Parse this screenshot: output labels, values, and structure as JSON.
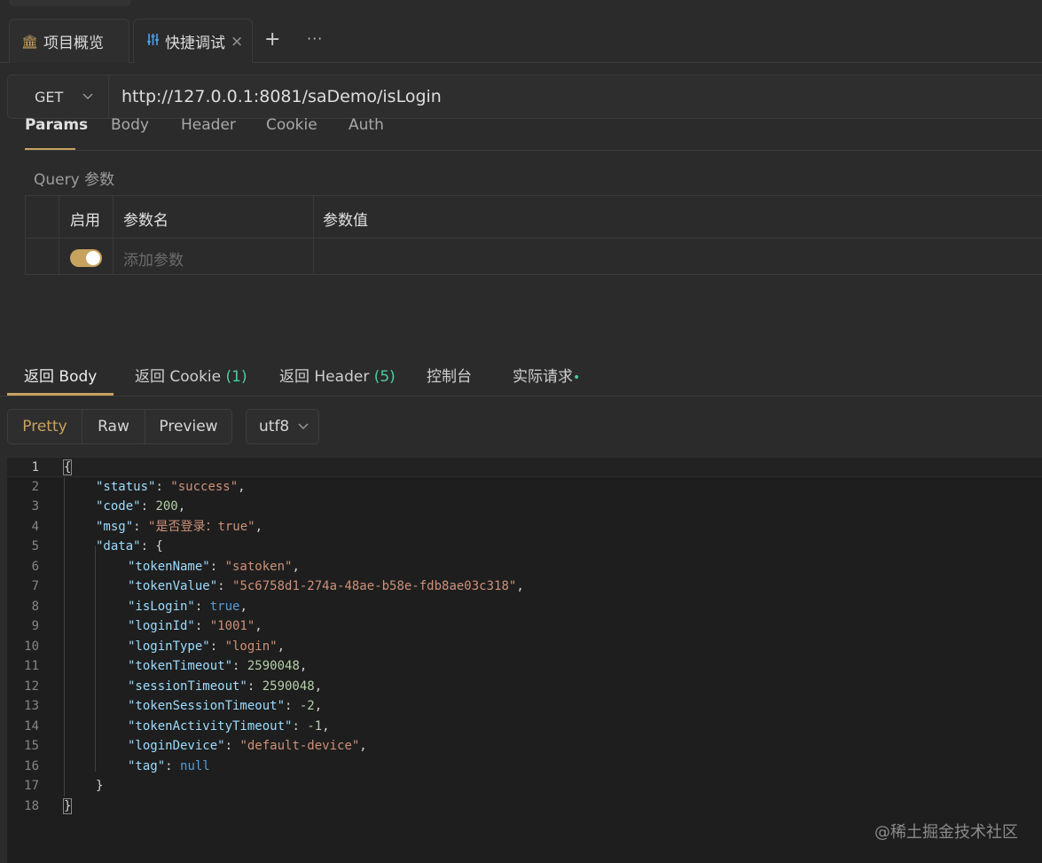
{
  "tabs": [
    {
      "label": "项目概览",
      "icon": "bank-icon"
    },
    {
      "label": "快捷调试",
      "icon": "sliders-icon",
      "close": "×"
    }
  ],
  "tab_actions": {
    "add": "+",
    "more": "···"
  },
  "request": {
    "method": "GET",
    "url": "http://127.0.0.1:8081/saDemo/isLogin"
  },
  "param_tabs": [
    "Params",
    "Body",
    "Header",
    "Cookie",
    "Auth"
  ],
  "query": {
    "label": "Query 参数",
    "headers": [
      "启用",
      "参数名",
      "参数值"
    ],
    "add_placeholder": "添加参数"
  },
  "response_tabs": [
    {
      "label": "返回 Body"
    },
    {
      "label": "返回 Cookie ",
      "count": "(1)"
    },
    {
      "label": "返回 Header ",
      "count": "(5)"
    },
    {
      "label": "控制台"
    },
    {
      "label": "实际请求",
      "dot": "•"
    }
  ],
  "view_modes": [
    "Pretty",
    "Raw",
    "Preview"
  ],
  "encoding": "utf8",
  "code_lines": [
    {
      "no": "1",
      "indent": 0,
      "tokens": [
        [
          "p",
          "{"
        ]
      ]
    },
    {
      "no": "2",
      "indent": 1,
      "tokens": [
        [
          "k",
          "\"status\""
        ],
        [
          "p",
          ": "
        ],
        [
          "s",
          "\"success\""
        ],
        [
          "p",
          ","
        ]
      ]
    },
    {
      "no": "3",
      "indent": 1,
      "tokens": [
        [
          "k",
          "\"code\""
        ],
        [
          "p",
          ": "
        ],
        [
          "n",
          "200"
        ],
        [
          "p",
          ","
        ]
      ]
    },
    {
      "no": "4",
      "indent": 1,
      "tokens": [
        [
          "k",
          "\"msg\""
        ],
        [
          "p",
          ": "
        ],
        [
          "s",
          "\"是否登录：true\""
        ],
        [
          "p",
          ","
        ]
      ]
    },
    {
      "no": "5",
      "indent": 1,
      "tokens": [
        [
          "k",
          "\"data\""
        ],
        [
          "p",
          ": {"
        ]
      ]
    },
    {
      "no": "6",
      "indent": 2,
      "tokens": [
        [
          "k",
          "\"tokenName\""
        ],
        [
          "p",
          ": "
        ],
        [
          "s",
          "\"satoken\""
        ],
        [
          "p",
          ","
        ]
      ]
    },
    {
      "no": "7",
      "indent": 2,
      "tokens": [
        [
          "k",
          "\"tokenValue\""
        ],
        [
          "p",
          ": "
        ],
        [
          "s",
          "\"5c6758d1-274a-48ae-b58e-fdb8ae03c318\""
        ],
        [
          "p",
          ","
        ]
      ]
    },
    {
      "no": "8",
      "indent": 2,
      "tokens": [
        [
          "k",
          "\"isLogin\""
        ],
        [
          "p",
          ": "
        ],
        [
          "b",
          "true"
        ],
        [
          "p",
          ","
        ]
      ]
    },
    {
      "no": "9",
      "indent": 2,
      "tokens": [
        [
          "k",
          "\"loginId\""
        ],
        [
          "p",
          ": "
        ],
        [
          "s",
          "\"1001\""
        ],
        [
          "p",
          ","
        ]
      ]
    },
    {
      "no": "10",
      "indent": 2,
      "tokens": [
        [
          "k",
          "\"loginType\""
        ],
        [
          "p",
          ": "
        ],
        [
          "s",
          "\"login\""
        ],
        [
          "p",
          ","
        ]
      ]
    },
    {
      "no": "11",
      "indent": 2,
      "tokens": [
        [
          "k",
          "\"tokenTimeout\""
        ],
        [
          "p",
          ": "
        ],
        [
          "n",
          "2590048"
        ],
        [
          "p",
          ","
        ]
      ]
    },
    {
      "no": "12",
      "indent": 2,
      "tokens": [
        [
          "k",
          "\"sessionTimeout\""
        ],
        [
          "p",
          ": "
        ],
        [
          "n",
          "2590048"
        ],
        [
          "p",
          ","
        ]
      ]
    },
    {
      "no": "13",
      "indent": 2,
      "tokens": [
        [
          "k",
          "\"tokenSessionTimeout\""
        ],
        [
          "p",
          ": "
        ],
        [
          "n",
          "-2"
        ],
        [
          "p",
          ","
        ]
      ]
    },
    {
      "no": "14",
      "indent": 2,
      "tokens": [
        [
          "k",
          "\"tokenActivityTimeout\""
        ],
        [
          "p",
          ": "
        ],
        [
          "n",
          "-1"
        ],
        [
          "p",
          ","
        ]
      ]
    },
    {
      "no": "15",
      "indent": 2,
      "tokens": [
        [
          "k",
          "\"loginDevice\""
        ],
        [
          "p",
          ": "
        ],
        [
          "s",
          "\"default-device\""
        ],
        [
          "p",
          ","
        ]
      ]
    },
    {
      "no": "16",
      "indent": 2,
      "tokens": [
        [
          "k",
          "\"tag\""
        ],
        [
          "p",
          ": "
        ],
        [
          "b",
          "null"
        ]
      ]
    },
    {
      "no": "17",
      "indent": 1,
      "tokens": [
        [
          "p",
          "}"
        ]
      ]
    },
    {
      "no": "18",
      "indent": 0,
      "tokens": [
        [
          "p",
          "}"
        ]
      ]
    }
  ],
  "watermark": "@稀土掘金技术社区",
  "colors": {
    "accent": "#c8a25f",
    "count": "#4ec9a0",
    "key": "#9cdcfe",
    "string": "#ce9178",
    "number": "#b5cea8",
    "keyword": "#569cd6"
  }
}
